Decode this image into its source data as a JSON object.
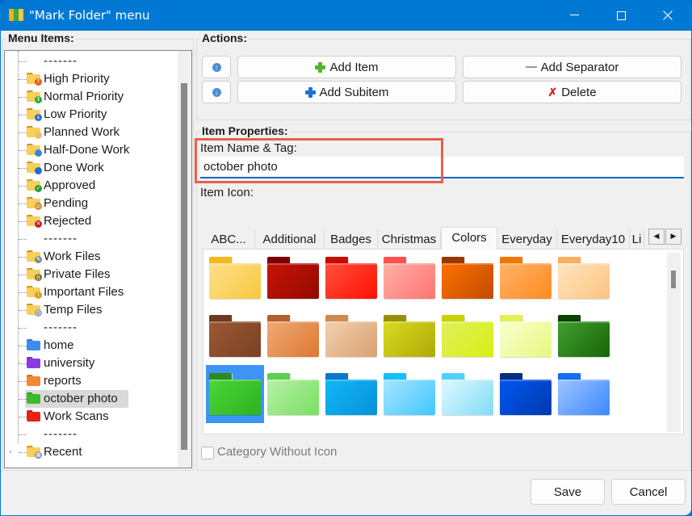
{
  "window": {
    "title": "\"Mark Folder\" menu",
    "controls": {
      "minimize": "—",
      "maximize": "☐",
      "close": "✕"
    }
  },
  "menu_items_panel": {
    "title": "Menu Items:",
    "items": [
      {
        "label": "-------",
        "type": "separator"
      },
      {
        "label": "High Priority",
        "icon": "folder-high-priority-icon",
        "badge_color": "#f05a1a",
        "badge_glyph": "↑"
      },
      {
        "label": "Normal Priority",
        "icon": "folder-normal-priority-icon",
        "badge_color": "#2ea836",
        "badge_glyph": "↕"
      },
      {
        "label": "Low Priority",
        "icon": "folder-low-priority-icon",
        "badge_color": "#2a6fd0",
        "badge_glyph": "↓"
      },
      {
        "label": "Planned Work",
        "icon": "folder-planned-icon",
        "badge_color": "#e8c070",
        "badge_glyph": ""
      },
      {
        "label": "Half-Done Work",
        "icon": "folder-half-done-icon",
        "badge_color": "#3a86d8",
        "badge_glyph": ""
      },
      {
        "label": "Done Work",
        "icon": "folder-done-icon",
        "badge_color": "#1e6fd0",
        "badge_glyph": ""
      },
      {
        "label": "Approved",
        "icon": "folder-approved-icon",
        "badge_color": "#2a9a3a",
        "badge_glyph": "✓"
      },
      {
        "label": "Pending",
        "icon": "folder-pending-icon",
        "badge_color": "#e8902a",
        "badge_glyph": "⌛"
      },
      {
        "label": "Rejected",
        "icon": "folder-rejected-icon",
        "badge_color": "#c02030",
        "badge_glyph": "✕"
      },
      {
        "label": "-------",
        "type": "separator"
      },
      {
        "label": "Work Files",
        "icon": "folder-work-files-icon",
        "badge_color": "#888888",
        "badge_glyph": "✎"
      },
      {
        "label": "Private Files",
        "icon": "folder-private-icon",
        "badge_color": "#666666",
        "badge_glyph": "🔒"
      },
      {
        "label": "Important Files",
        "icon": "folder-important-icon",
        "badge_color": "#d8a020",
        "badge_glyph": "!"
      },
      {
        "label": "Temp Files",
        "icon": "folder-temp-icon",
        "badge_color": "#9aa0a8",
        "badge_glyph": "◷"
      },
      {
        "label": "-------",
        "type": "separator"
      },
      {
        "label": "home",
        "icon": "folder-blue-icon",
        "folder_color": "#3a8ef0"
      },
      {
        "label": "university",
        "icon": "folder-purple-icon",
        "folder_color": "#8a3ae0"
      },
      {
        "label": "reports",
        "icon": "folder-orange-icon",
        "folder_color": "#f08a30"
      },
      {
        "label": "october photo",
        "icon": "folder-green-icon",
        "folder_color": "#3cba2e",
        "selected": true
      },
      {
        "label": "Work Scans",
        "icon": "folder-red-icon",
        "folder_color": "#e8201a"
      },
      {
        "label": "-------",
        "type": "separator"
      },
      {
        "label": "Recent",
        "icon": "folder-recent-icon",
        "badge_color": "#7a8aa0",
        "badge_glyph": "▦",
        "expandable": true
      }
    ]
  },
  "actions_panel": {
    "title": "Actions:",
    "move_up": "↑",
    "move_down": "↓",
    "add_item": "Add Item",
    "add_separator": "Add Separator",
    "add_subitem": "Add Subitem",
    "delete": "Delete"
  },
  "item_properties": {
    "title": "Item Properties:",
    "name_label": "Item Name & Tag:",
    "name_value": "october photo",
    "icon_label": "Item Icon:",
    "tabs": [
      {
        "label": "ABC..."
      },
      {
        "label": "Additional"
      },
      {
        "label": "Badges"
      },
      {
        "label": "Christmas"
      },
      {
        "label": "Colors",
        "active": true
      },
      {
        "label": "Everyday"
      },
      {
        "label": "Everyday10"
      },
      {
        "label": "Li"
      }
    ],
    "icons": [
      {
        "name": "yellow",
        "tab": "#f5b820",
        "top": "#ffe08a",
        "bottom": "#f7c840"
      },
      {
        "name": "dark-red",
        "tab": "#7a0000",
        "top": "#c81408",
        "bottom": "#920a00"
      },
      {
        "name": "red",
        "tab": "#c80a00",
        "top": "#ff5040",
        "bottom": "#ff1000"
      },
      {
        "name": "pink",
        "tab": "#ff5050",
        "top": "#ffb0a8",
        "bottom": "#ff7470"
      },
      {
        "name": "dark-orange",
        "tab": "#983800",
        "top": "#ff7000",
        "bottom": "#c04c00"
      },
      {
        "name": "orange",
        "tab": "#f07800",
        "top": "#ffb468",
        "bottom": "#ff8a20"
      },
      {
        "name": "peach",
        "tab": "#f8b060",
        "top": "#ffe4c0",
        "bottom": "#fcc480"
      },
      {
        "name": "brown",
        "tab": "#6a3a20",
        "top": "#9a5a34",
        "bottom": "#7a4024"
      },
      {
        "name": "tan",
        "tab": "#b06030",
        "top": "#f0aa78",
        "bottom": "#dc7830"
      },
      {
        "name": "beige",
        "tab": "#d08a50",
        "top": "#f0d0b0",
        "bottom": "#dca070"
      },
      {
        "name": "olive",
        "tab": "#989008",
        "top": "#d8dc20",
        "bottom": "#b0a808"
      },
      {
        "name": "lime",
        "tab": "#c8d000",
        "top": "#e0f060",
        "bottom": "#d8f010"
      },
      {
        "name": "light-lime",
        "tab": "#e4f050",
        "top": "#f8ffd0",
        "bottom": "#e8f880"
      },
      {
        "name": "dark-green",
        "tab": "#0a4000",
        "top": "#40a030",
        "bottom": "#186408"
      },
      {
        "name": "green",
        "tab": "#2a8a20",
        "top": "#48d838",
        "bottom": "#30b020",
        "selected": true
      },
      {
        "name": "light-green",
        "tab": "#58d050",
        "top": "#b8f0a8",
        "bottom": "#78e060"
      },
      {
        "name": "cyan-blue",
        "tab": "#0a78c8",
        "top": "#10b8f8",
        "bottom": "#0890d8"
      },
      {
        "name": "sky-blue",
        "tab": "#10c0ff",
        "top": "#a8e4ff",
        "bottom": "#40c8ff"
      },
      {
        "name": "ice-blue",
        "tab": "#50d0ff",
        "top": "#e0f8ff",
        "bottom": "#80dcf8"
      },
      {
        "name": "navy",
        "tab": "#003080",
        "top": "#0058f0",
        "bottom": "#0038b0"
      },
      {
        "name": "blue",
        "tab": "#1070f0",
        "top": "#a0c4ff",
        "bottom": "#3a88ff"
      }
    ],
    "category_without_icon": "Category Without Icon",
    "category_without_icon_checked": false
  },
  "footer": {
    "save": "Save",
    "cancel": "Cancel"
  },
  "colors": {
    "accent": "#0078d4",
    "highlight_box": "#e8604a",
    "selection": "#3d94f6"
  }
}
